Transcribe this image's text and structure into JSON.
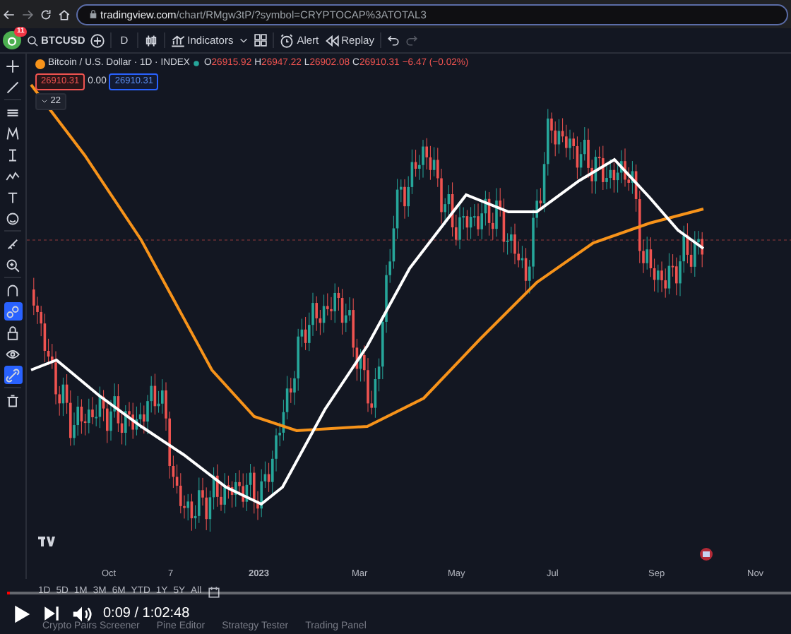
{
  "browser": {
    "url_domain": "tradingview.com",
    "url_path": "/chart/RMgw3tP/?symbol=CRYPTOCAP%3ATOTAL3"
  },
  "toolbar": {
    "notification_count": "11",
    "symbol": "BTCUSD",
    "interval": "D",
    "indicators": "Indicators",
    "alert": "Alert",
    "replay": "Replay"
  },
  "legend": {
    "title": "Bitcoin / U.S. Dollar · 1D · INDEX",
    "ohlc": [
      {
        "label": "O",
        "value": "26915.92"
      },
      {
        "label": "H",
        "value": "26947.22"
      },
      {
        "label": "L",
        "value": "26902.08"
      },
      {
        "label": "C",
        "value": "26910.31"
      }
    ],
    "change": "−6.47 (−0.02%)",
    "sell_price": "26910.31",
    "spread": "0.00",
    "buy_price": "26910.31",
    "indicator_count": "22"
  },
  "left_tools": [
    {
      "selected": false
    },
    {
      "selected": false
    },
    {
      "selected": false
    },
    {
      "selected": false
    },
    {
      "selected": false
    },
    {
      "selected": false
    },
    {
      "selected": false
    },
    {
      "selected": false
    },
    {
      "selected": false
    },
    {
      "selected": false
    },
    {
      "selected": false
    },
    {
      "selected": true
    },
    {
      "selected": false
    },
    {
      "selected": false
    },
    {
      "selected": true
    },
    {
      "selected": false
    }
  ],
  "time_axis": [
    "Oct",
    "7",
    "2023",
    "Mar",
    "May",
    "Jul",
    "Sep",
    "Nov"
  ],
  "ranges": [
    "1D",
    "5D",
    "1M",
    "3M",
    "6M",
    "YTD",
    "1Y",
    "5Y",
    "All"
  ],
  "bottom_tabs": [
    "Crypto Pairs Screener",
    "Pine Editor",
    "Strategy Tester",
    "Trading Panel"
  ],
  "video": {
    "time": "0:09 / 1:02:48",
    "level": 0.004
  }
}
